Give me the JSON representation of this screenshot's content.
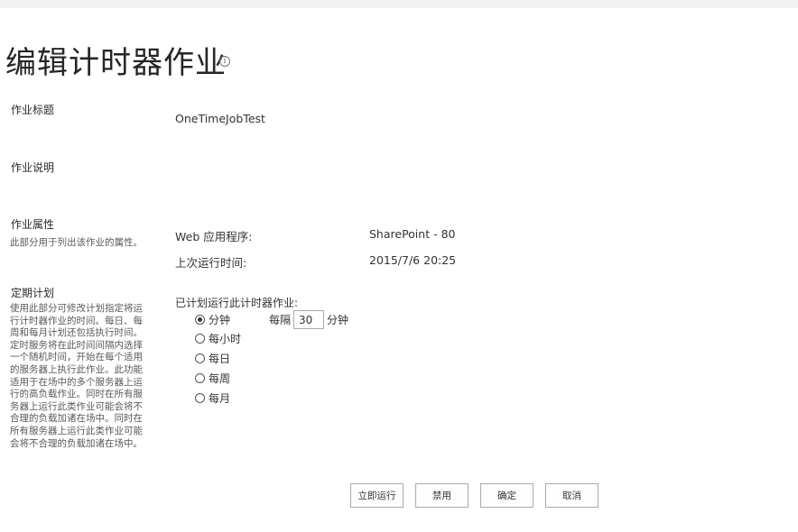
{
  "page": {
    "title": "编辑计时器作业",
    "info_icon": "info-icon"
  },
  "sections": {
    "job_title": {
      "label": "作业标题",
      "value": "OneTimeJobTest"
    },
    "job_description": {
      "label": "作业说明"
    },
    "job_properties": {
      "label": "作业属性",
      "description": "此部分用于列出该作业的属性。",
      "web_app_label": "Web 应用程序:",
      "web_app_value": "SharePoint - 80",
      "last_run_label": "上次运行时间:",
      "last_run_value": "2015/7/6 20:25"
    },
    "schedule": {
      "label": "定期计划",
      "description": "使用此部分可修改计划指定将运行计时器作业的时间。每日、每周和每月计划还包括执行时间。定时服务将在此时间间隔内选择一个随机时间，开始在每个适用的服务器上执行此作业。此功能适用于在场中的多个服务器上运行的高负载作业。同时在所有服务器上运行此类作业可能会将不合理的负载加诸在场中。同时在所有服务器上运行此类作业可能会将不合理的负载加诸在场中。",
      "prompt": "已计划运行此计时器作业:",
      "options": [
        "分钟",
        "每小时",
        "每日",
        "每周",
        "每月"
      ],
      "selected": "分钟",
      "every_label": "每隔",
      "every_value": "30",
      "unit_label": "分钟"
    }
  },
  "buttons": {
    "run_now": "立即运行",
    "disable": "禁用",
    "ok": "确定",
    "cancel": "取消"
  }
}
